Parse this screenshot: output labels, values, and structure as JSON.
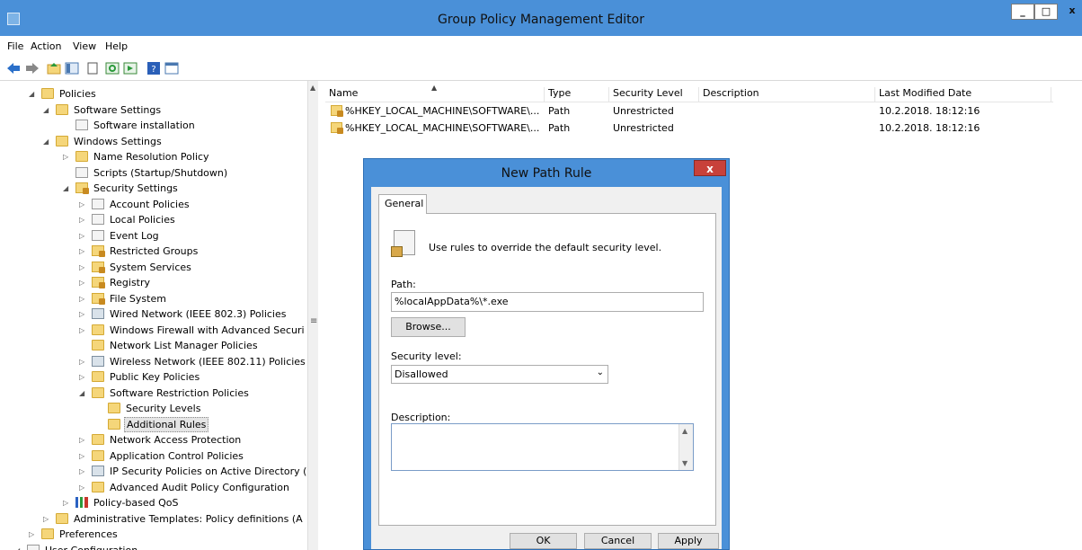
{
  "window": {
    "title": "Group Policy Management Editor",
    "controls": {
      "minimize": "_",
      "maximize": "□",
      "close": "x"
    }
  },
  "menu": [
    "File",
    "Action",
    "View",
    "Help"
  ],
  "toolbar": {
    "icons": [
      "back-icon",
      "forward-icon",
      "up-folder-icon",
      "show-hide-tree-icon",
      "clipboard-icon",
      "refresh-icon",
      "export-list-icon",
      "help-icon",
      "properties-icon"
    ]
  },
  "tree": [
    {
      "label": "Policies",
      "depth": 1,
      "expanded": "open",
      "icon": "folder"
    },
    {
      "label": "Software Settings",
      "depth": 2,
      "expanded": "open",
      "icon": "folder"
    },
    {
      "label": "Software installation",
      "depth": 3,
      "expanded": "",
      "icon": "doc"
    },
    {
      "label": "Windows Settings",
      "depth": 2,
      "expanded": "open",
      "icon": "folder"
    },
    {
      "label": "Name Resolution Policy",
      "depth": 3,
      "expanded": "closed",
      "icon": "folder"
    },
    {
      "label": "Scripts (Startup/Shutdown)",
      "depth": 3,
      "expanded": "",
      "icon": "doc"
    },
    {
      "label": "Security Settings",
      "depth": 3,
      "expanded": "open",
      "icon": "shield"
    },
    {
      "label": "Account Policies",
      "depth": 4,
      "expanded": "closed",
      "icon": "doc"
    },
    {
      "label": "Local Policies",
      "depth": 4,
      "expanded": "closed",
      "icon": "doc"
    },
    {
      "label": "Event Log",
      "depth": 4,
      "expanded": "closed",
      "icon": "doc"
    },
    {
      "label": "Restricted Groups",
      "depth": 4,
      "expanded": "closed",
      "icon": "shield"
    },
    {
      "label": "System Services",
      "depth": 4,
      "expanded": "closed",
      "icon": "shield"
    },
    {
      "label": "Registry",
      "depth": 4,
      "expanded": "closed",
      "icon": "shield"
    },
    {
      "label": "File System",
      "depth": 4,
      "expanded": "closed",
      "icon": "shield"
    },
    {
      "label": "Wired Network (IEEE 802.3) Policies",
      "depth": 4,
      "expanded": "closed",
      "icon": "net"
    },
    {
      "label": "Windows Firewall with Advanced Securi",
      "depth": 4,
      "expanded": "closed",
      "icon": "folder"
    },
    {
      "label": "Network List Manager Policies",
      "depth": 4,
      "expanded": "",
      "icon": "folder"
    },
    {
      "label": "Wireless Network (IEEE 802.11) Policies",
      "depth": 4,
      "expanded": "closed",
      "icon": "net"
    },
    {
      "label": "Public Key Policies",
      "depth": 4,
      "expanded": "closed",
      "icon": "folder"
    },
    {
      "label": "Software Restriction Policies",
      "depth": 4,
      "expanded": "open",
      "icon": "folder"
    },
    {
      "label": "Security Levels",
      "depth": 5,
      "expanded": "",
      "icon": "folder"
    },
    {
      "label": "Additional Rules",
      "depth": 5,
      "expanded": "",
      "icon": "folder",
      "selected": true
    },
    {
      "label": "Network Access Protection",
      "depth": 4,
      "expanded": "closed",
      "icon": "folder"
    },
    {
      "label": "Application Control Policies",
      "depth": 4,
      "expanded": "closed",
      "icon": "folder"
    },
    {
      "label": "IP Security Policies on Active Directory (",
      "depth": 4,
      "expanded": "closed",
      "icon": "net"
    },
    {
      "label": "Advanced Audit Policy Configuration",
      "depth": 4,
      "expanded": "closed",
      "icon": "folder"
    },
    {
      "label": "Policy-based QoS",
      "depth": 3,
      "expanded": "closed",
      "icon": "bars"
    },
    {
      "label": "Administrative Templates: Policy definitions (A",
      "depth": 2,
      "expanded": "closed",
      "icon": "folder"
    },
    {
      "label": "Preferences",
      "depth": 1,
      "expanded": "closed",
      "icon": "folder"
    },
    {
      "label": "User Configuration",
      "depth": 0,
      "expanded": "open",
      "icon": "doc"
    }
  ],
  "list": {
    "columns": [
      "Name",
      "Type",
      "Security Level",
      "Description",
      "Last Modified Date"
    ],
    "rows": [
      {
        "name": "%HKEY_LOCAL_MACHINE\\SOFTWARE\\...",
        "type": "Path",
        "level": "Unrestricted",
        "description": "",
        "modified": "10.2.2018. 18:12:16"
      },
      {
        "name": "%HKEY_LOCAL_MACHINE\\SOFTWARE\\...",
        "type": "Path",
        "level": "Unrestricted",
        "description": "",
        "modified": "10.2.2018. 18:12:16"
      }
    ]
  },
  "dialog": {
    "title": "New Path Rule",
    "close": "x",
    "tab": "General",
    "info": "Use rules to override the default security level.",
    "path_label": "Path:",
    "path_value": "%localAppData%\\*.exe",
    "browse": "Browse...",
    "security_label": "Security level:",
    "security_value": "Disallowed",
    "description_label": "Description:",
    "description_value": "",
    "ok": "OK",
    "cancel": "Cancel",
    "apply": "Apply"
  }
}
